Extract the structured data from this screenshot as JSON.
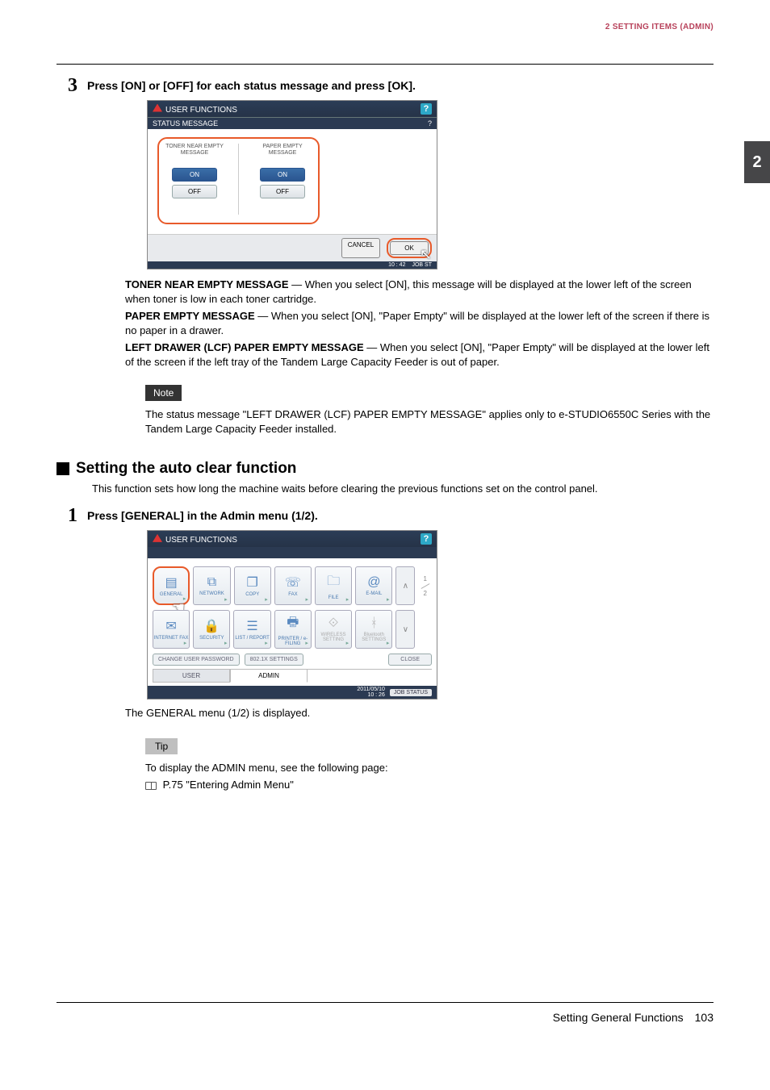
{
  "header": {
    "breadcrumb": "2 SETTING ITEMS (ADMIN)"
  },
  "side_tab": "2",
  "step3": {
    "num": "3",
    "text": "Press [ON] or [OFF] for each status message and press [OK].",
    "screen": {
      "title": "USER FUNCTIONS",
      "subtitle": "STATUS MESSAGE",
      "help": "?",
      "cols": [
        {
          "label": "TONER NEAR EMPTY MESSAGE",
          "on": "ON",
          "off": "OFF"
        },
        {
          "label": "PAPER EMPTY MESSAGE",
          "on": "ON",
          "off": "OFF"
        }
      ],
      "cancel": "CANCEL",
      "ok": "OK",
      "time": "10 : 42",
      "jobstatus": "JOB ST"
    },
    "desc": [
      {
        "b": "TONER NEAR EMPTY MESSAGE",
        "t": " — When you select [ON], this message will be displayed at the lower left of the screen when toner is low in each toner cartridge."
      },
      {
        "b": "PAPER EMPTY MESSAGE",
        "t": " — When you select [ON], \"Paper Empty\" will be displayed at the lower left of the screen if there is no paper in a drawer."
      },
      {
        "b": "LEFT DRAWER (LCF) PAPER EMPTY MESSAGE",
        "t": " — When you select [ON], \"Paper Empty\" will be displayed at the lower left of the screen if the left tray of the Tandem Large Capacity Feeder is out of paper."
      }
    ],
    "note_label": "Note",
    "note": "The status message \"LEFT DRAWER (LCF) PAPER EMPTY MESSAGE\" applies only to e-STUDIO6550C Series with the Tandem Large Capacity Feeder installed."
  },
  "section": {
    "title": "Setting the auto clear function",
    "desc": "This function sets how long the machine waits before clearing the previous functions set on the control panel."
  },
  "step1": {
    "num": "1",
    "text": "Press [GENERAL] in the Admin menu (1/2).",
    "screen": {
      "title": "USER FUNCTIONS",
      "help": "?",
      "row1": [
        "GENERAL",
        "NETWORK",
        "COPY",
        "FAX",
        "FILE",
        "E-MAIL"
      ],
      "row2": [
        "INTERNET FAX",
        "SECURITY",
        "LIST / REPORT",
        "PRINTER / e-FILING",
        "WIRELESS SETTING",
        "Bluetooth SETTINGS"
      ],
      "pager_up": "∧",
      "pager_down": "∨",
      "page_cur": "1",
      "page_tot": "2",
      "btns": {
        "chpass": "CHANGE USER PASSWORD",
        "dot1x": "802.1X SETTINGS",
        "close": "CLOSE"
      },
      "tabs": {
        "user": "USER",
        "admin": "ADMIN"
      },
      "datetime": "2011/05/10\n10 : 26",
      "jobstatus": "JOB STATUS"
    },
    "post": "The GENERAL menu (1/2) is displayed.",
    "tip_label": "Tip",
    "tip1": "To display the ADMIN menu, see the following page:",
    "tip2": " P.75 \"Entering Admin Menu\""
  },
  "footer": {
    "title": "Setting General Functions",
    "page": "103"
  }
}
